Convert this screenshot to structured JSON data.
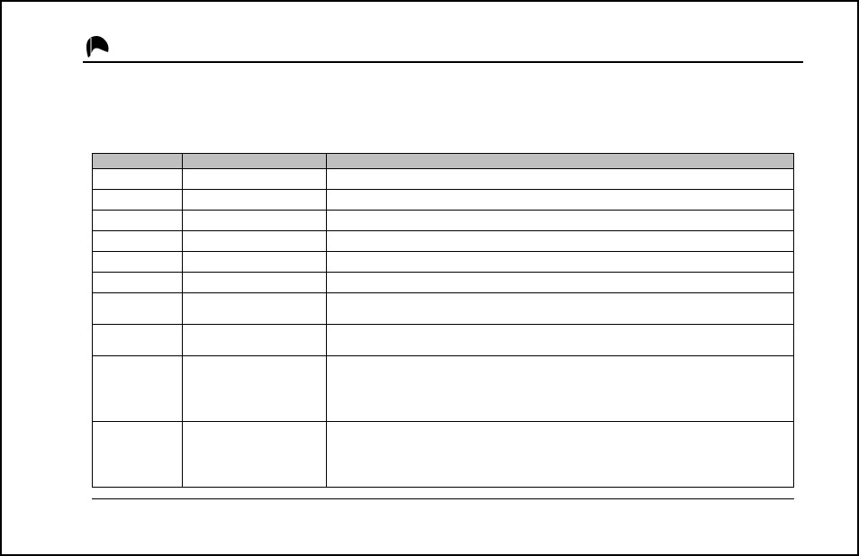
{
  "header": {
    "title": ""
  },
  "table": {
    "headers": [
      "",
      "",
      ""
    ],
    "rows": [
      {
        "size": "sm",
        "cells": [
          "",
          "",
          ""
        ]
      },
      {
        "size": "sm",
        "cells": [
          "",
          "",
          ""
        ]
      },
      {
        "size": "sm",
        "cells": [
          "",
          "",
          ""
        ]
      },
      {
        "size": "sm",
        "cells": [
          "",
          "",
          ""
        ]
      },
      {
        "size": "sm",
        "cells": [
          "",
          "",
          ""
        ]
      },
      {
        "size": "sm",
        "cells": [
          "",
          "",
          ""
        ]
      },
      {
        "size": "md",
        "cells": [
          "",
          "",
          ""
        ]
      },
      {
        "size": "md",
        "cells": [
          "",
          "",
          ""
        ]
      },
      {
        "size": "lg",
        "cells": [
          "",
          "",
          ""
        ]
      },
      {
        "size": "lg",
        "cells": [
          "",
          "",
          ""
        ]
      }
    ]
  }
}
